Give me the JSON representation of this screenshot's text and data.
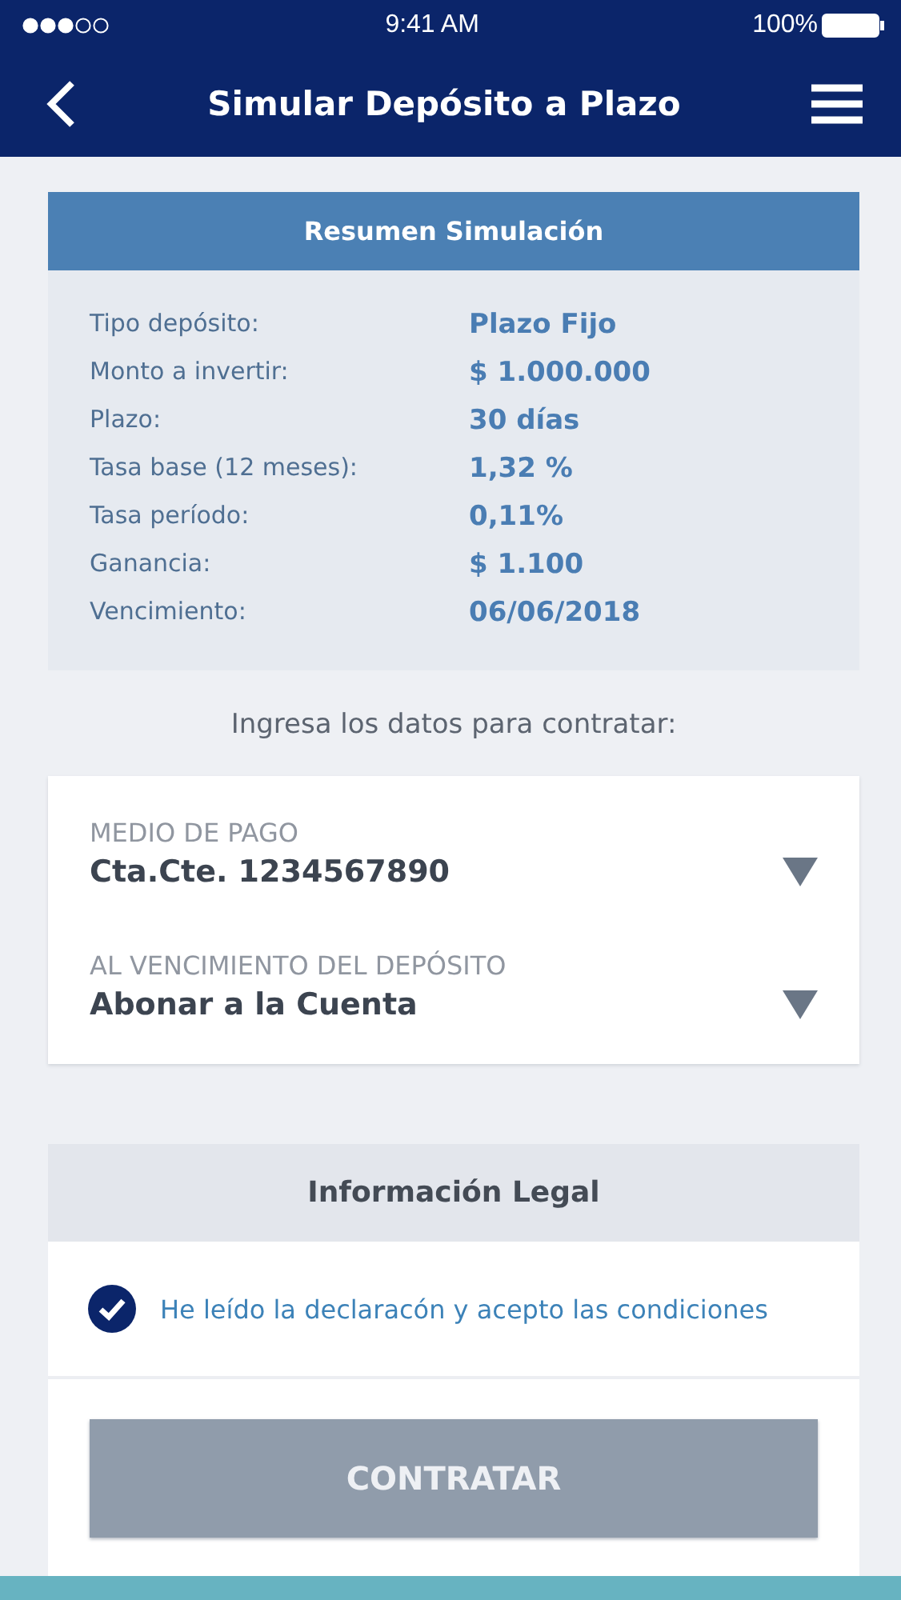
{
  "status_bar": {
    "time": "9:41 AM",
    "battery": "100%"
  },
  "nav_bar": {
    "title": "Simular Depósito a Plazo"
  },
  "summary": {
    "title": "Resumen Simulación",
    "rows": [
      {
        "label": "Tipo depósito:",
        "value": "Plazo Fijo"
      },
      {
        "label": "Monto a invertir:",
        "value": "$ 1.000.000"
      },
      {
        "label": "Plazo:",
        "value": "30 días"
      },
      {
        "label": "Tasa base (12 meses):",
        "value": "1,32 %"
      },
      {
        "label": "Tasa período:",
        "value": "0,11%"
      },
      {
        "label": "Ganancia:",
        "value": "$ 1.100"
      },
      {
        "label": "Vencimiento:",
        "value": "06/06/2018"
      }
    ]
  },
  "instruction": "Ingresa los datos para contratar:",
  "form_fields": [
    {
      "label": "MEDIO DE PAGO",
      "value": "Cta.Cte. 1234567890"
    },
    {
      "label": "AL VENCIMIENTO DEL DEPÓSITO",
      "value": "Abonar a la Cuenta"
    }
  ],
  "legal": {
    "title": "Información Legal",
    "checkbox": {
      "label": "He leído la declaracón y acepto las condiciones",
      "checked": true
    }
  },
  "submit_button": {
    "label": "CONTRATAR",
    "disabled": true
  }
}
